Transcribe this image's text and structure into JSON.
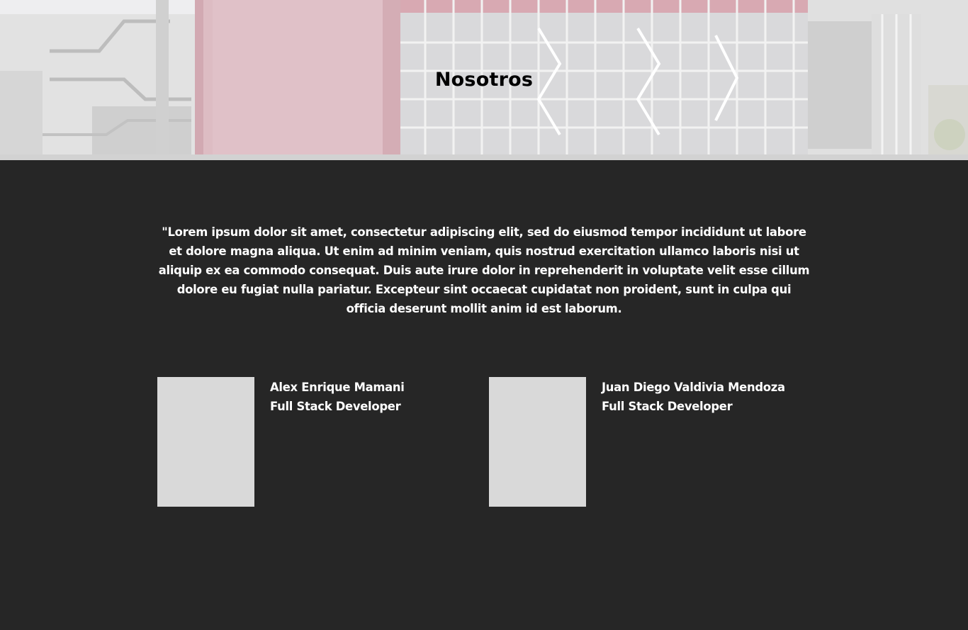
{
  "hero": {
    "title": "Nosotros"
  },
  "about": {
    "text": "\"Lorem ipsum dolor sit amet, consectetur adipiscing elit, sed do eiusmod tempor incididunt ut labore et dolore magna aliqua. Ut enim ad minim veniam, quis nostrud exercitation ullamco laboris nisi ut aliquip ex ea commodo consequat. Duis aute irure dolor in reprehenderit in voluptate velit esse cillum dolore eu fugiat nulla pariatur. Excepteur sint occaecat cupidatat non proident, sunt in culpa qui officia deserunt mollit anim id est laborum."
  },
  "team": [
    {
      "name": "Alex Enrique Mamani",
      "role": "Full Stack Developer"
    },
    {
      "name": "Juan Diego Valdivia Mendoza",
      "role": "Full Stack Developer"
    }
  ],
  "colors": {
    "background": "#262626",
    "text": "#ffffff",
    "photo_placeholder": "#d9d9d9",
    "hero_accent": "#e0b7bf"
  }
}
